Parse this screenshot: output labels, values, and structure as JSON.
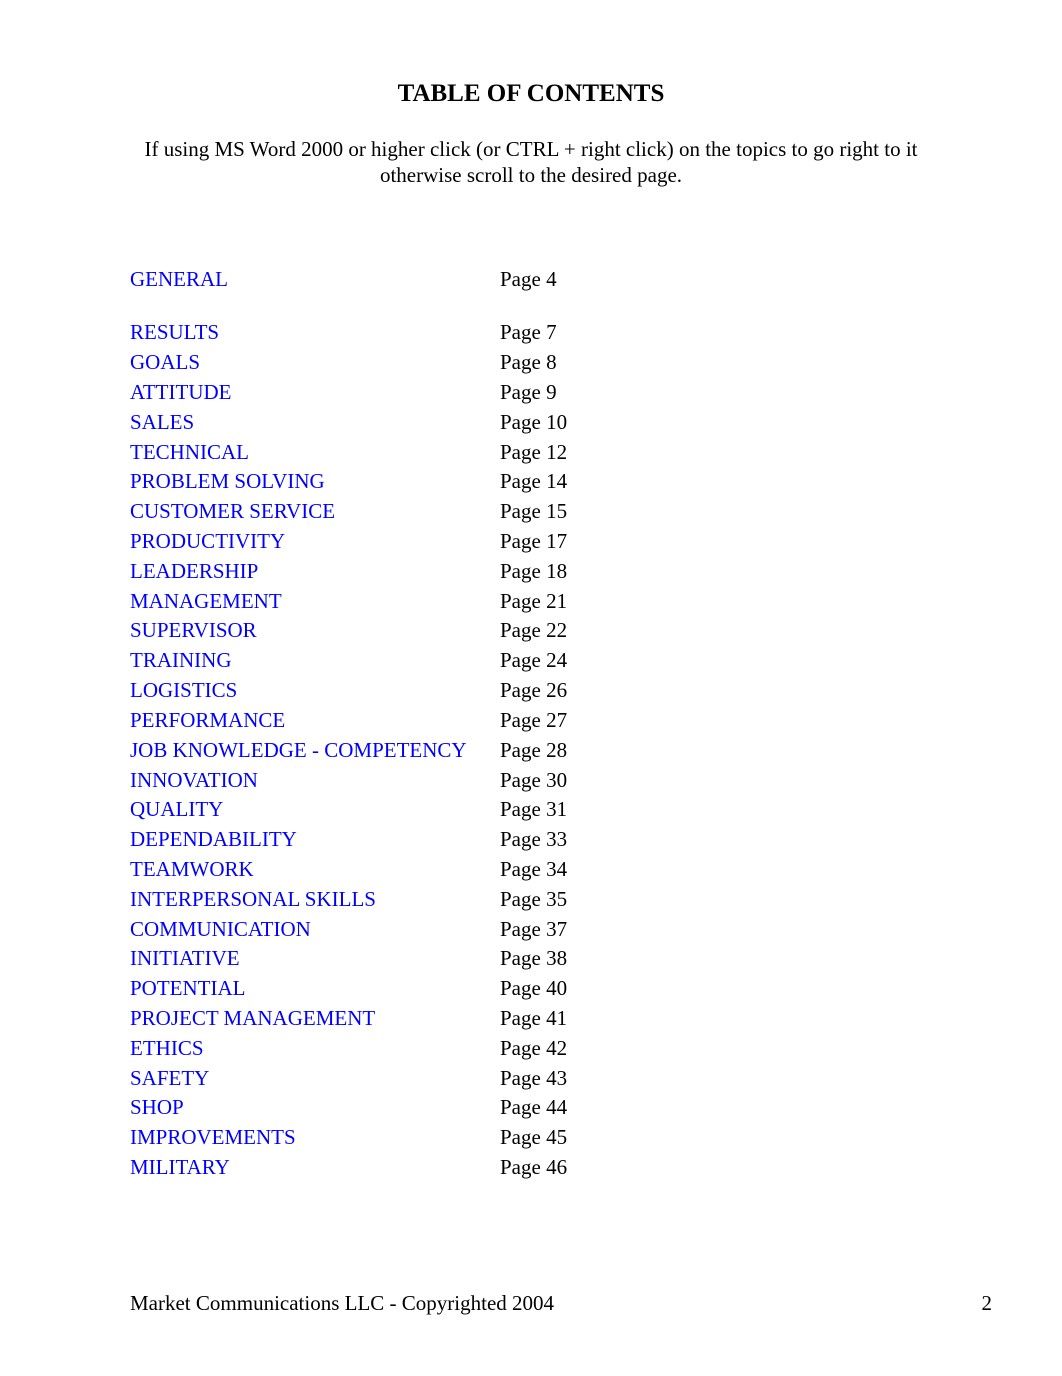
{
  "title": "TABLE OF CONTENTS",
  "instruction_line1": "If using MS Word 2000 or higher click (or CTRL + right click) on the topics to go right to it",
  "instruction_line2": "otherwise scroll to the desired page.",
  "top_entry": {
    "topic": "GENERAL",
    "page": "Page 4"
  },
  "entries": [
    {
      "topic": "RESULTS",
      "page": "Page 7"
    },
    {
      "topic": "GOALS",
      "page": "Page 8"
    },
    {
      "topic": "ATTITUDE",
      "page": "Page 9"
    },
    {
      "topic": "SALES",
      "page": "Page 10"
    },
    {
      "topic": "TECHNICAL",
      "page": "Page 12"
    },
    {
      "topic": "PROBLEM SOLVING",
      "page": "Page 14"
    },
    {
      "topic": "CUSTOMER SERVICE",
      "page": "Page 15"
    },
    {
      "topic": "PRODUCTIVITY",
      "page": "Page 17"
    },
    {
      "topic": "LEADERSHIP",
      "page": "Page 18"
    },
    {
      "topic": "MANAGEMENT",
      "page": "Page 21"
    },
    {
      "topic": "SUPERVISOR",
      "page": "Page 22"
    },
    {
      "topic": "TRAINING",
      "page": "Page 24"
    },
    {
      "topic": "LOGISTICS",
      "page": "Page 26"
    },
    {
      "topic": "PERFORMANCE",
      "page": "Page 27"
    },
    {
      "topic": "JOB KNOWLEDGE - COMPETENCY",
      "page": "Page 28"
    },
    {
      "topic": "INNOVATION",
      "page": "Page 30"
    },
    {
      "topic": "QUALITY",
      "page": "Page 31"
    },
    {
      "topic": "DEPENDABILITY",
      "page": "Page 33"
    },
    {
      "topic": "TEAMWORK",
      "page": "Page 34"
    },
    {
      "topic": "INTERPERSONAL SKILLS",
      "page": "Page 35"
    },
    {
      "topic": "COMMUNICATION",
      "page": "Page 37"
    },
    {
      "topic": "INITIATIVE",
      "page": "Page 38"
    },
    {
      "topic": "POTENTIAL",
      "page": "Page 40"
    },
    {
      "topic": "PROJECT MANAGEMENT",
      "page": "Page 41"
    },
    {
      "topic": "ETHICS",
      "page": "Page 42"
    },
    {
      "topic": "SAFETY",
      "page": "Page 43"
    },
    {
      "topic": "SHOP",
      "page": "Page 44"
    },
    {
      "topic": "IMPROVEMENTS",
      "page": "Page 45"
    },
    {
      "topic": "MILITARY",
      "page": "Page 46"
    }
  ],
  "footer": {
    "left": "Market Communications LLC - Copyrighted 2004",
    "right": "2"
  }
}
